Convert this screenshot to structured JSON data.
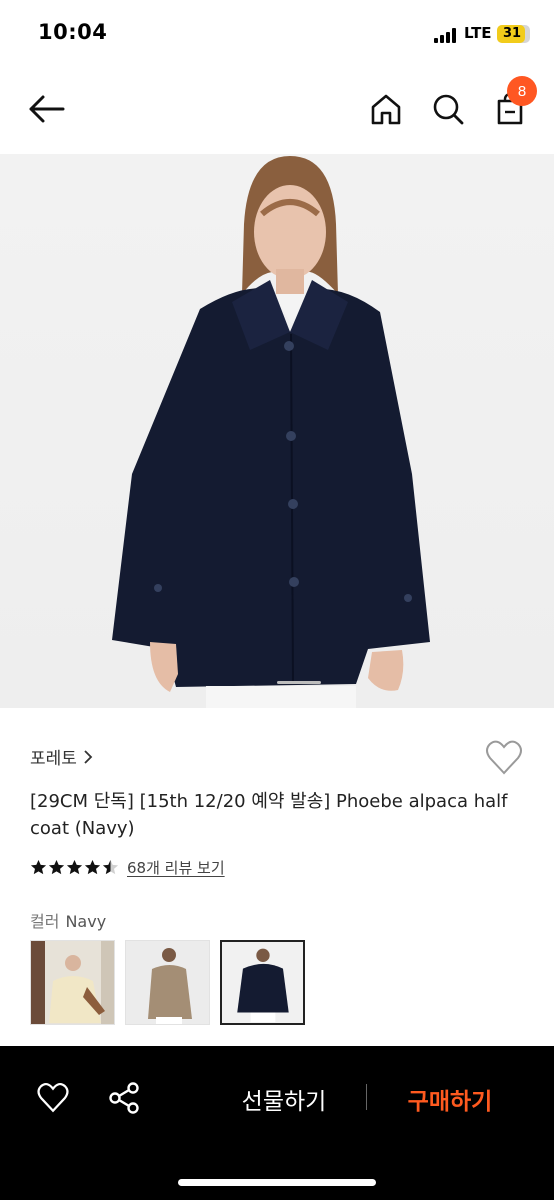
{
  "status_bar": {
    "time": "10:04",
    "network": "LTE",
    "battery": "31"
  },
  "header": {
    "icons": [
      "back-arrow-icon",
      "home-icon",
      "search-icon",
      "cart-icon"
    ],
    "cart_count": "8"
  },
  "product": {
    "brand": "포레토",
    "title": "[29CM 단독] [15th 12/20 예약 발송] Phoebe alpaca half coat (Navy)",
    "rating": 4.5,
    "review_text": "68개 리뷰 보기",
    "color_label": "컬러",
    "color_value": "Navy"
  },
  "colors": {
    "accent": "#ff5722",
    "buy": "#ff5a1f",
    "coat": "#141b31"
  },
  "bottom_bar": {
    "gift_label": "선물하기",
    "buy_label": "구매하기",
    "icons": [
      "heart-icon",
      "share-icon"
    ]
  }
}
